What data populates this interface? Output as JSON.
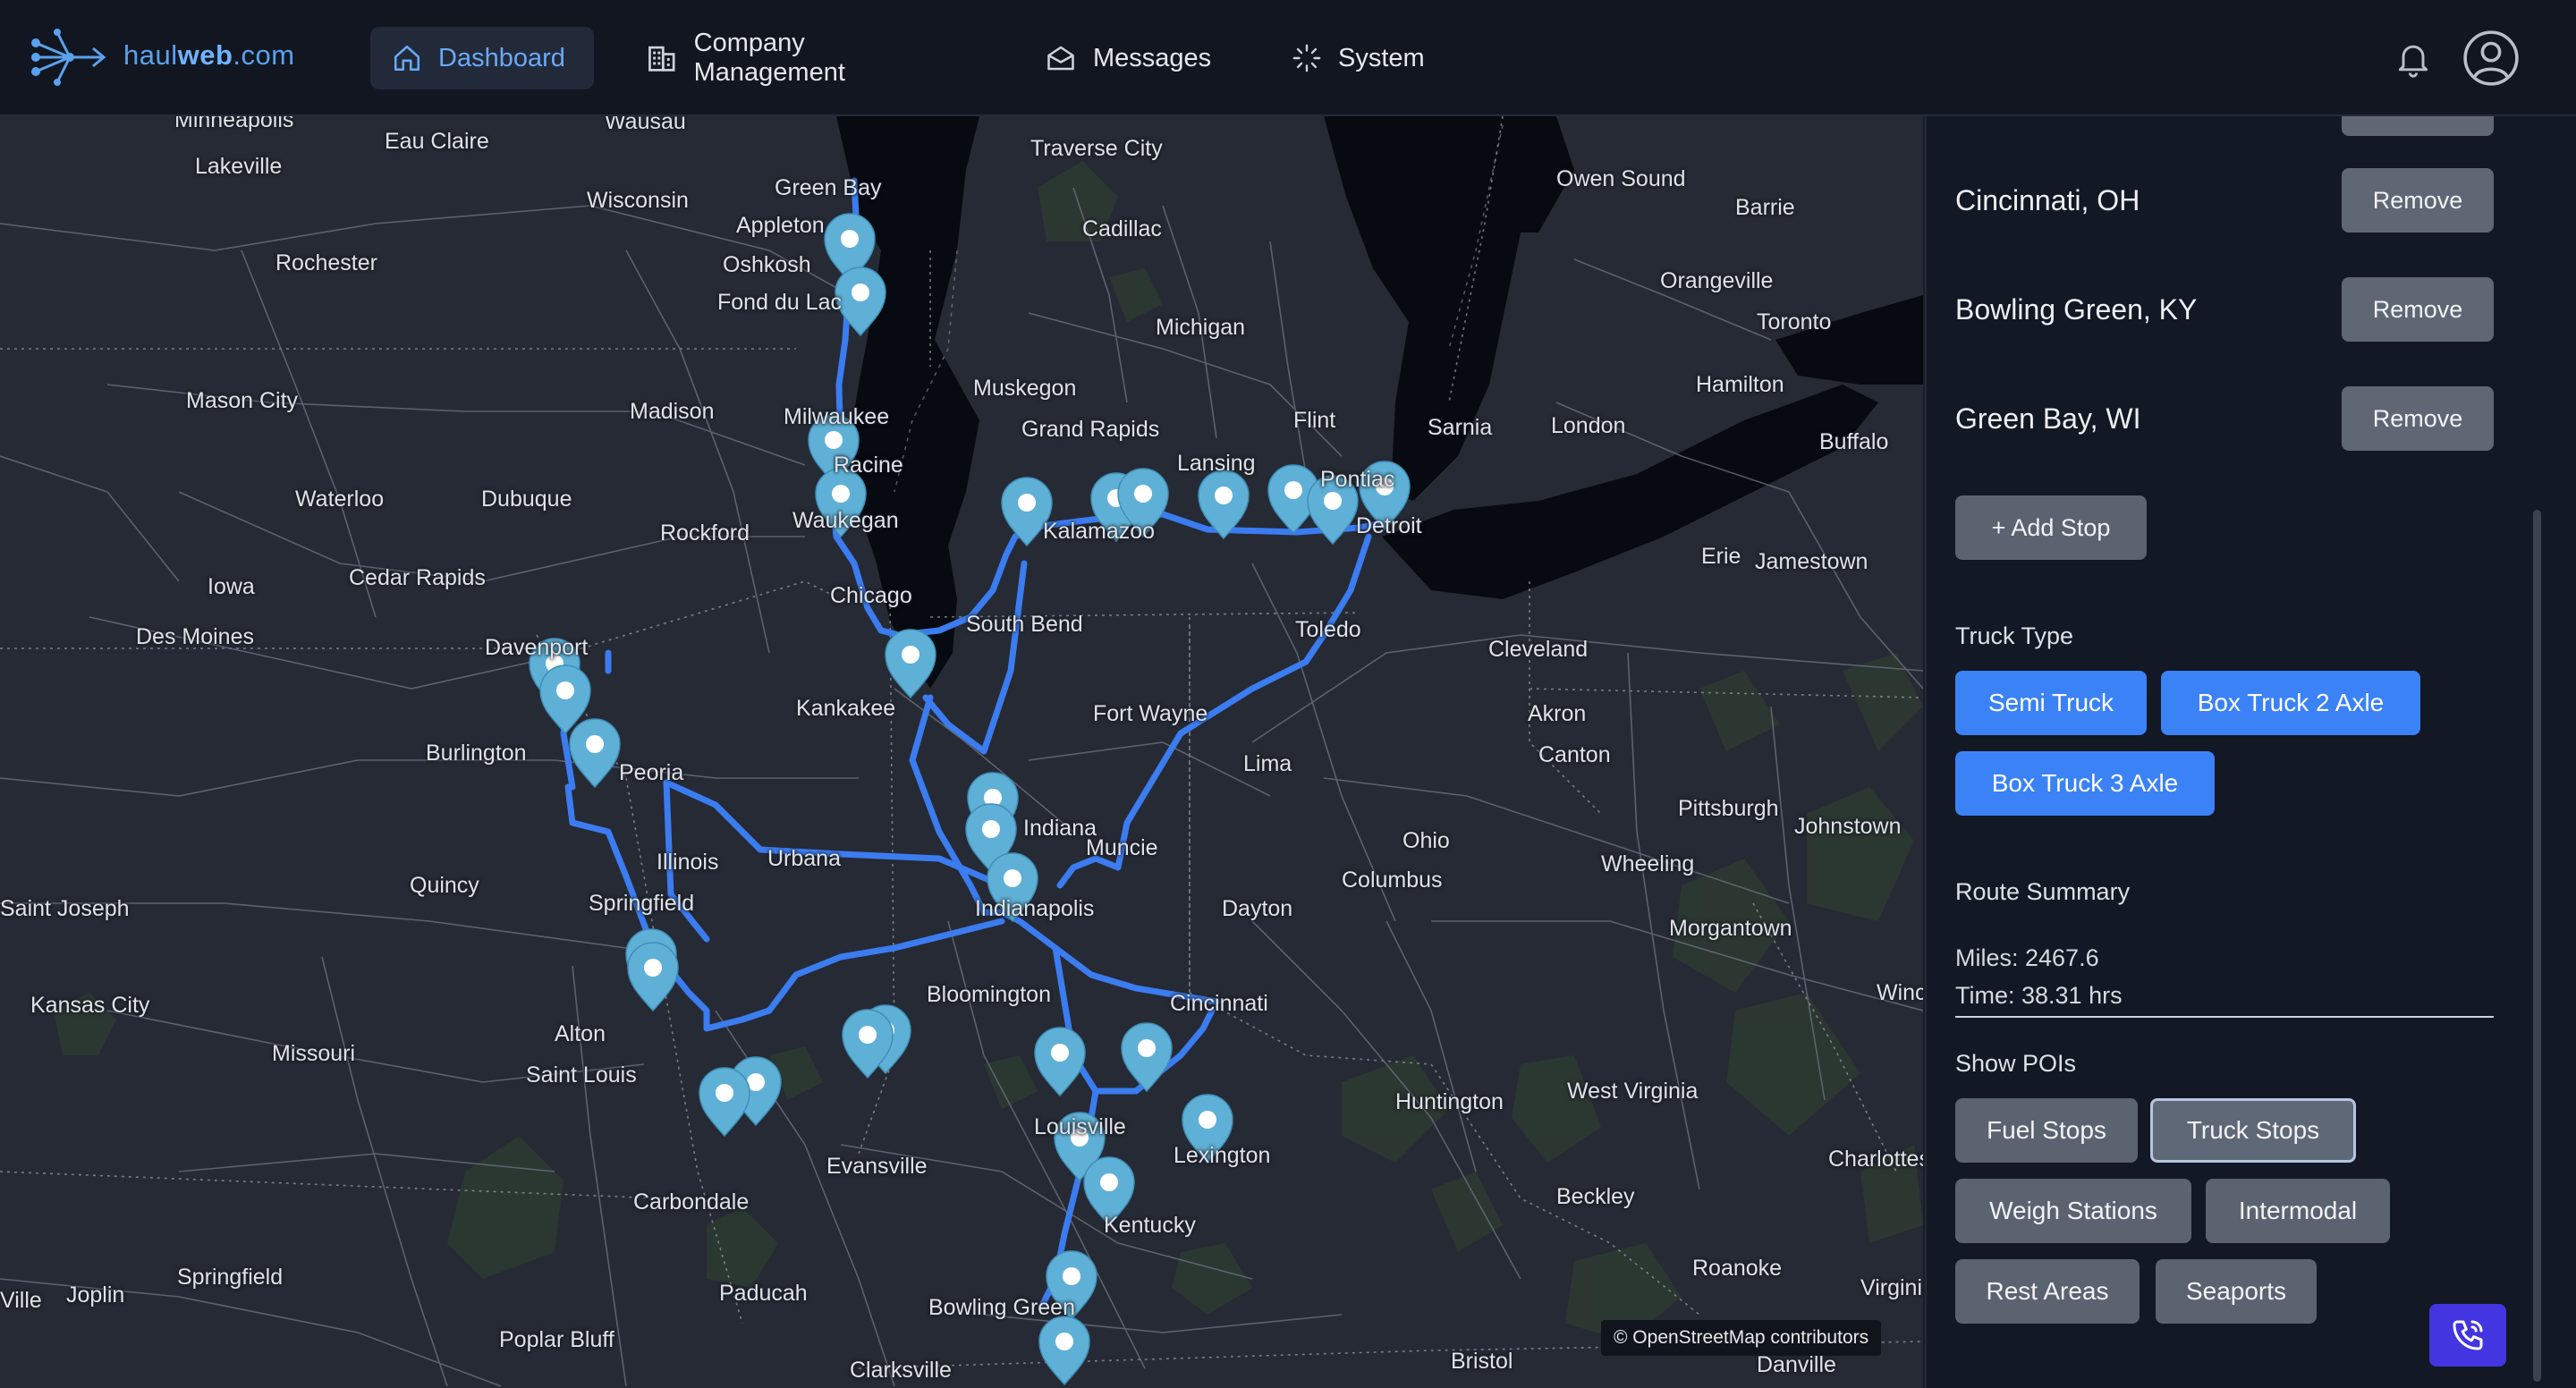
{
  "app": {
    "brand_prefix": "haul",
    "brand_mid": "web",
    "brand_suffix": ".com"
  },
  "nav": [
    {
      "label": "Dashboard",
      "icon": "home-icon",
      "active": true
    },
    {
      "label": "Company Management",
      "icon": "building-icon"
    },
    {
      "label": "Messages",
      "icon": "envelope-icon"
    },
    {
      "label": "System",
      "icon": "loader-icon"
    }
  ],
  "map": {
    "attribution": "© OpenStreetMap contributors",
    "cities": [
      {
        "name": "Minneapolis"
      },
      {
        "name": "Wausau"
      },
      {
        "name": "Traverse City"
      },
      {
        "name": "Eau Claire"
      },
      {
        "name": "Lakeville"
      },
      {
        "name": "Green Bay"
      },
      {
        "name": "Appleton"
      },
      {
        "name": "Wisconsin"
      },
      {
        "name": "Oshkosh"
      },
      {
        "name": "Cadillac"
      },
      {
        "name": "Owen Sound"
      },
      {
        "name": "Barrie"
      },
      {
        "name": "Rochester"
      },
      {
        "name": "Fond du Lac"
      },
      {
        "name": "Michigan"
      },
      {
        "name": "Orangeville"
      },
      {
        "name": "Toronto"
      },
      {
        "name": "Muskegon"
      },
      {
        "name": "Hamilton"
      },
      {
        "name": "Mason City"
      },
      {
        "name": "Madison"
      },
      {
        "name": "Milwaukee"
      },
      {
        "name": "Grand Rapids"
      },
      {
        "name": "Flint"
      },
      {
        "name": "Sarnia"
      },
      {
        "name": "London"
      },
      {
        "name": "Buffalo"
      },
      {
        "name": "Lansing"
      },
      {
        "name": "Racine"
      },
      {
        "name": "Pontiac"
      },
      {
        "name": "Waterloo"
      },
      {
        "name": "Dubuque"
      },
      {
        "name": "Waukegan"
      },
      {
        "name": "Rockford"
      },
      {
        "name": "Kalamazoo"
      },
      {
        "name": "Detroit"
      },
      {
        "name": "Erie"
      },
      {
        "name": "Jamestown"
      },
      {
        "name": "Iowa"
      },
      {
        "name": "Cedar Rapids"
      },
      {
        "name": "Chicago"
      },
      {
        "name": "Des Moines"
      },
      {
        "name": "South Bend"
      },
      {
        "name": "Toledo"
      },
      {
        "name": "Davenport"
      },
      {
        "name": "Cleveland"
      },
      {
        "name": "Kankakee"
      },
      {
        "name": "Fort Wayne"
      },
      {
        "name": "Akron"
      },
      {
        "name": "Burlington"
      },
      {
        "name": "Canton"
      },
      {
        "name": "Lima"
      },
      {
        "name": "Peoria"
      },
      {
        "name": "Pittsburgh"
      },
      {
        "name": "Indiana"
      },
      {
        "name": "Johnstown"
      },
      {
        "name": "Ohio"
      },
      {
        "name": "Muncie"
      },
      {
        "name": "Urbana"
      },
      {
        "name": "Illinois"
      },
      {
        "name": "Wheeling"
      },
      {
        "name": "Quincy"
      },
      {
        "name": "Columbus"
      },
      {
        "name": "Saint Joseph"
      },
      {
        "name": "Springfield"
      },
      {
        "name": "Indianapolis"
      },
      {
        "name": "Dayton"
      },
      {
        "name": "Morgantown"
      },
      {
        "name": "Kansas City"
      },
      {
        "name": "Bloomington"
      },
      {
        "name": "Cincinnati"
      },
      {
        "name": "Winchester"
      },
      {
        "name": "Alton"
      },
      {
        "name": "Missouri"
      },
      {
        "name": "Saint Louis"
      },
      {
        "name": "Huntington"
      },
      {
        "name": "West Virginia"
      },
      {
        "name": "Louisville"
      },
      {
        "name": "Lexington"
      },
      {
        "name": "Charlottesville"
      },
      {
        "name": "Evansville"
      },
      {
        "name": "Carbondale"
      },
      {
        "name": "Beckley"
      },
      {
        "name": "Kentucky"
      },
      {
        "name": "Springfield"
      },
      {
        "name": "Roanoke"
      },
      {
        "name": "Joplin"
      },
      {
        "name": "Paducah"
      },
      {
        "name": "Virginia"
      },
      {
        "name": "Bowling Green"
      },
      {
        "name": "Poplar Bluff"
      },
      {
        "name": "Bristol"
      },
      {
        "name": "Clarksville"
      },
      {
        "name": "Danville"
      },
      {
        "name": "Ville"
      }
    ]
  },
  "sidebar": {
    "stops": [
      {
        "name": "Cincinnati, OH",
        "action": "Remove"
      },
      {
        "name": "Bowling Green, KY",
        "action": "Remove"
      },
      {
        "name": "Green Bay, WI",
        "action": "Remove"
      }
    ],
    "add_stop_label": "+ Add Stop",
    "truck_type_label": "Truck Type",
    "truck_types": [
      {
        "label": "Semi Truck"
      },
      {
        "label": "Box Truck 2 Axle"
      },
      {
        "label": "Box Truck 3 Axle"
      }
    ],
    "route_summary_label": "Route Summary",
    "miles_text": "Miles: 2467.6",
    "time_text": "Time: 38.31 hrs",
    "show_pois_label": "Show POIs",
    "pois": [
      {
        "label": "Fuel Stops",
        "active": false
      },
      {
        "label": "Truck Stops",
        "active": true
      },
      {
        "label": "Weigh Stations",
        "active": false
      },
      {
        "label": "Intermodal",
        "active": false
      },
      {
        "label": "Rest Areas",
        "active": false
      },
      {
        "label": "Seaports",
        "active": false
      }
    ]
  },
  "colors": {
    "route": "#3b7cf0",
    "marker": "#5fb0d6",
    "accent": "#3b82f6",
    "call_button": "#4335e0"
  }
}
